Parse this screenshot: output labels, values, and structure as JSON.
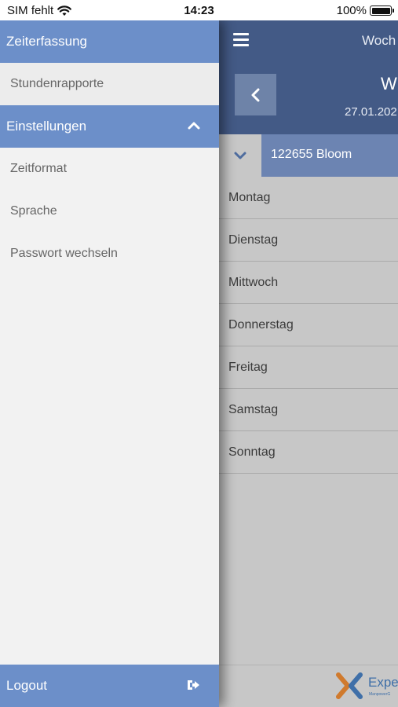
{
  "status_bar": {
    "carrier": "SIM fehlt",
    "time": "14:23",
    "battery": "100%"
  },
  "drawer": {
    "sections": [
      {
        "header": "Zeiterfassung",
        "items": [
          "Stundenrapporte"
        ]
      },
      {
        "header": "Einstellungen",
        "items": [
          "Zeitformat",
          "Sprache",
          "Passwort wechseln"
        ]
      }
    ],
    "logout_label": "Logout"
  },
  "main": {
    "header_title": "Woch",
    "week_label": "W",
    "week_date": "27.01.202",
    "project_label": "122655 Bloom",
    "days": [
      "Montag",
      "Dienstag",
      "Mittwoch",
      "Donnerstag",
      "Freitag",
      "Samstag",
      "Sonntag"
    ],
    "logo_text": "Exper",
    "logo_subtext": "ManpowerG"
  },
  "colors": {
    "drawer_header": "#6c8fc9",
    "topbar": "#435a86",
    "project_bar": "#6c84b2",
    "overlay_gray": "#c7c7c7"
  }
}
